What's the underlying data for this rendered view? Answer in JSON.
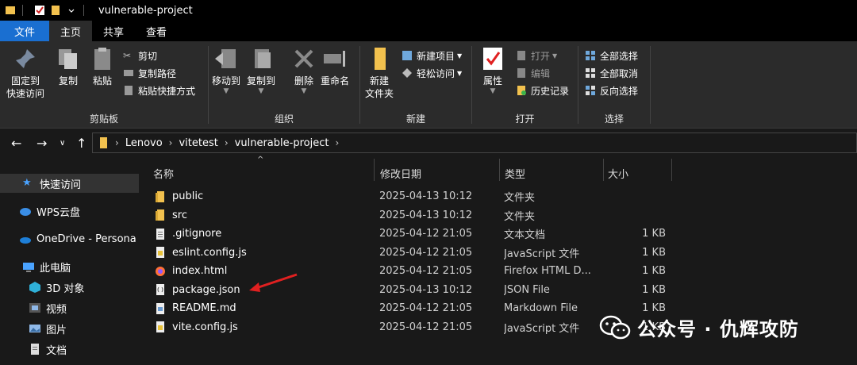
{
  "window": {
    "title": "vulnerable-project"
  },
  "tabs": [
    "文件",
    "主页",
    "共享",
    "查看"
  ],
  "ribbon": {
    "clipboard": {
      "label": "剪贴板",
      "pin_line1": "固定到",
      "pin_line2": "快速访问",
      "copy": "复制",
      "paste": "粘贴",
      "cut": "剪切",
      "copy_path": "复制路径",
      "paste_shortcut": "粘贴快捷方式"
    },
    "organize": {
      "label": "组织",
      "move_to": "移动到",
      "copy_to": "复制到",
      "delete": "删除",
      "rename": "重命名"
    },
    "new": {
      "label": "新建",
      "new_folder_line1": "新建",
      "new_folder_line2": "文件夹",
      "new_item": "新建项目",
      "easy_access": "轻松访问"
    },
    "open": {
      "label": "打开",
      "properties": "属性",
      "open": "打开",
      "edit": "编辑",
      "history": "历史记录"
    },
    "select": {
      "label": "选择",
      "select_all": "全部选择",
      "select_none": "全部取消",
      "invert": "反向选择"
    }
  },
  "address": {
    "crumbs": [
      "Lenovo",
      "vitetest",
      "vulnerable-project"
    ]
  },
  "nav": {
    "quick_access": "快速访问",
    "wps": "WPS云盘",
    "onedrive": "OneDrive - Persona",
    "this_pc": "此电脑",
    "objects3d": "3D 对象",
    "videos": "视频",
    "pictures": "图片",
    "documents": "文档"
  },
  "columns": {
    "name": "名称",
    "date": "修改日期",
    "type": "类型",
    "size": "大小"
  },
  "files": [
    {
      "name": "public",
      "date": "2025-04-13 10:12",
      "type": "文件夹",
      "size": "",
      "icon": "folder-icon"
    },
    {
      "name": "src",
      "date": "2025-04-13 10:12",
      "type": "文件夹",
      "size": "",
      "icon": "folder-icon"
    },
    {
      "name": ".gitignore",
      "date": "2025-04-12 21:05",
      "type": "文本文档",
      "size": "1 KB",
      "icon": "text-file-icon"
    },
    {
      "name": "eslint.config.js",
      "date": "2025-04-12 21:05",
      "type": "JavaScript 文件",
      "size": "1 KB",
      "icon": "js-file-icon"
    },
    {
      "name": "index.html",
      "date": "2025-04-12 21:05",
      "type": "Firefox HTML D...",
      "size": "1 KB",
      "icon": "firefox-icon"
    },
    {
      "name": "package.json",
      "date": "2025-04-13 10:12",
      "type": "JSON File",
      "size": "1 KB",
      "icon": "json-file-icon"
    },
    {
      "name": "README.md",
      "date": "2025-04-12 21:05",
      "type": "Markdown File",
      "size": "1 KB",
      "icon": "markdown-file-icon"
    },
    {
      "name": "vite.config.js",
      "date": "2025-04-12 21:05",
      "type": "JavaScript 文件",
      "size": "1 KB",
      "icon": "js-file-icon"
    }
  ],
  "watermark": {
    "text": "公众号 · 仇辉攻防"
  },
  "colors": {
    "accent": "#1a6fd1",
    "arrow": "#e02020",
    "folder": "#f2c14e"
  }
}
